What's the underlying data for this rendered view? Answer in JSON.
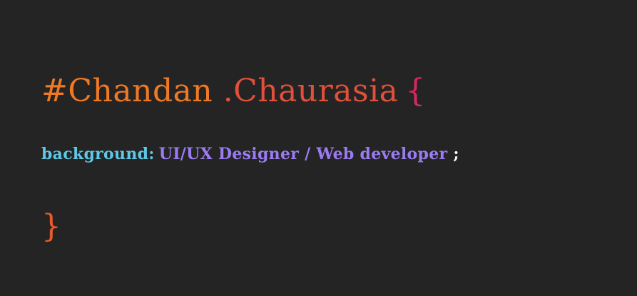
{
  "code": {
    "id_selector": "#Chandan",
    "class_selector": ".Chaurasia",
    "open_brace": "{",
    "property": "background:",
    "value": "UI/UX Designer / Web developer",
    "semicolon": ";",
    "close_brace": "}"
  },
  "colors": {
    "background": "#242424",
    "id_selector": "#f07a24",
    "class_selector": "#e0503a",
    "open_brace": "#d62a5e",
    "property": "#5fc8e6",
    "value": "#9b7bf2",
    "semicolon": "#ffffff",
    "close_brace": "#e85a2c"
  }
}
